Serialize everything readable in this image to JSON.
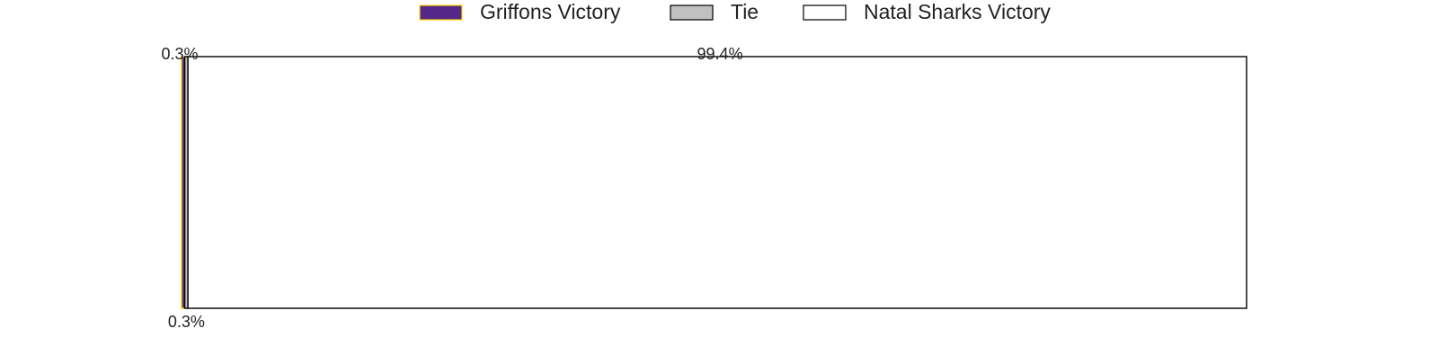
{
  "chart_data": {
    "type": "bar",
    "orientation": "horizontal",
    "stacked": true,
    "legend": {
      "placement": "top"
    },
    "series": [
      {
        "name": "Griffons Victory",
        "value": 0.3,
        "label": "0.3%",
        "color": "#542788",
        "edge": "#FFD700"
      },
      {
        "name": "Tie",
        "value": 0.3,
        "label": "0.3%",
        "color": "#C0C0C0",
        "edge": "#000000"
      },
      {
        "name": "Natal Sharks Victory",
        "value": 99.4,
        "label": "99.4%",
        "color": "#FFFFFF",
        "edge": "#000000"
      }
    ],
    "xlim": [
      0,
      100
    ],
    "grid": false,
    "axes_visible": false
  }
}
